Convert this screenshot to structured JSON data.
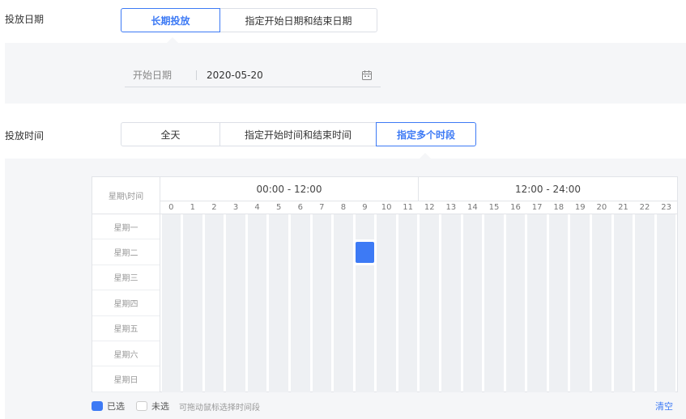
{
  "delivery_date": {
    "label": "投放日期",
    "options": [
      "长期投放",
      "指定开始日期和结束日期"
    ],
    "selected": "长期投放",
    "start_date_label": "开始日期",
    "start_date_value": "2020-05-20",
    "calendar_icon": "calendar-icon"
  },
  "delivery_time": {
    "label": "投放时间",
    "options": [
      "全天",
      "指定开始时间和结束时间",
      "指定多个时段"
    ],
    "selected": "指定多个时段"
  },
  "schedule": {
    "corner_label": "星期\\时间",
    "halves": [
      "00:00 - 12:00",
      "12:00 - 24:00"
    ],
    "hours": [
      "0",
      "1",
      "2",
      "3",
      "4",
      "5",
      "6",
      "7",
      "8",
      "9",
      "10",
      "11",
      "12",
      "13",
      "14",
      "15",
      "16",
      "17",
      "18",
      "19",
      "20",
      "21",
      "22",
      "23"
    ],
    "days": [
      "星期一",
      "星期二",
      "星期三",
      "星期四",
      "星期五",
      "星期六",
      "星期日"
    ],
    "selected_slots": [
      {
        "day": "星期二",
        "hour": "9"
      }
    ],
    "selected_color": "#3d7af5",
    "legend_selected": "已选",
    "legend_unselected": "未选",
    "hint": "可拖动鼠标选择时间段",
    "clear_label": "清空"
  }
}
